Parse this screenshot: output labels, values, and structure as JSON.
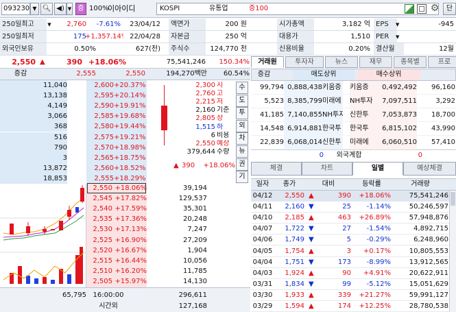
{
  "toolbar": {
    "code": "093230",
    "pct_badge": "100%",
    "name": "이아이디",
    "market": "KOSPI",
    "sector": "유통업",
    "margin": "증100"
  },
  "info": {
    "r1": [
      "250일최고",
      "2,760",
      "-7.61%",
      "23/04/12",
      "액면가",
      "200 원",
      "시가총액",
      "3,182 억",
      "EPS",
      "-945"
    ],
    "r2": [
      "250일최저",
      "175",
      "+1,357.14%",
      "22/04/28",
      "자본금",
      "250 억",
      "대용가",
      "1,510",
      "PER",
      ""
    ],
    "r3": [
      "외국인보유",
      "0.50%",
      "627(천)",
      "주식수",
      "124,770 천",
      "신용비율",
      "0.20%",
      "결산월",
      "12월"
    ]
  },
  "price": {
    "now": "2,550",
    "arrow": "▲",
    "chg": "390",
    "pct": "+18.06%",
    "vol": "75,541,246",
    "ratio": "150.34%"
  },
  "sub": {
    "label": "증감",
    "v1": "2,555",
    "v2": "2,550",
    "amt": "194,270백만",
    "turn": "60.54%"
  },
  "asks": [
    {
      "q": "11,040",
      "p": "2,600",
      "r": "+20.37%"
    },
    {
      "q": "13,138",
      "p": "2,595",
      "r": "+20.14%"
    },
    {
      "q": "4,149",
      "p": "2,590",
      "r": "+19.91%"
    },
    {
      "q": "3,066",
      "p": "2,585",
      "r": "+19.68%"
    },
    {
      "q": "368",
      "p": "2,580",
      "r": "+19.44%"
    },
    {
      "q": "516",
      "p": "2,575",
      "r": "+19.21%"
    },
    {
      "q": "790",
      "p": "2,570",
      "r": "+18.98%"
    },
    {
      "q": "3",
      "p": "2,565",
      "r": "+18.75%"
    },
    {
      "q": "13,872",
      "p": "2,560",
      "r": "+18.52%"
    },
    {
      "q": "18,853",
      "p": "2,555",
      "r": "+18.29%"
    }
  ],
  "bids": [
    {
      "p": "2,550",
      "r": "+18.06%",
      "q": "39,194"
    },
    {
      "p": "2,545",
      "r": "+17.82%",
      "q": "129,537"
    },
    {
      "p": "2,540",
      "r": "+17.59%",
      "q": "35,301"
    },
    {
      "p": "2,535",
      "r": "+17.36%",
      "q": "20,248"
    },
    {
      "p": "2,530",
      "r": "+17.13%",
      "q": "7,247"
    },
    {
      "p": "2,525",
      "r": "+16.90%",
      "q": "27,209"
    },
    {
      "p": "2,520",
      "r": "+16.67%",
      "q": "1,904"
    },
    {
      "p": "2,515",
      "r": "+16.44%",
      "q": "10,056"
    },
    {
      "p": "2,510",
      "r": "+16.20%",
      "q": "11,785"
    },
    {
      "p": "2,505",
      "r": "+15.97%",
      "q": "14,130"
    }
  ],
  "ohlc": [
    {
      "v": "2,300",
      "k": "시",
      "c": "red"
    },
    {
      "v": "2,760",
      "k": "고",
      "c": "red"
    },
    {
      "v": "2,215",
      "k": "저",
      "c": "red"
    },
    {
      "v": "2,160",
      "k": "기준",
      "c": "black"
    },
    {
      "v": "2,805",
      "k": "상",
      "c": "red"
    },
    {
      "v": "1,515",
      "k": "하",
      "c": "blue"
    },
    {
      "v": "6",
      "k": "비용",
      "c": "black"
    },
    {
      "v": "2,550",
      "k": "예상",
      "c": "red"
    },
    {
      "v": "379,644",
      "k": "수량",
      "c": "black"
    }
  ],
  "expected": {
    "arrow": "▲",
    "chg": "390",
    "pct": "+18.06%"
  },
  "side_buttons": [
    "수",
    "도",
    "투",
    "외",
    "차",
    "뉴",
    "권",
    "기"
  ],
  "totals": {
    "ask_total": "65,795",
    "time": "16:00:00",
    "bid_total": "296,611",
    "after_label": "시간외",
    "after_qty": "127,168"
  },
  "rtabs": [
    "거래원",
    "투자자",
    "뉴스",
    "재무",
    "종목별",
    "프로"
  ],
  "broker": {
    "h_sell": "매도상위",
    "h_buy": "매수상위",
    "lbl": "증감",
    "rows": [
      [
        "99,794",
        "0,888,438",
        "키움증",
        "키움증",
        "0,492,492",
        "96,160"
      ],
      [
        "5,523",
        "8,385,799",
        "미래에",
        "NH투자",
        "7,097,511",
        "3,292"
      ],
      [
        "41,185",
        "7,140,855",
        "NH투자",
        "신한투",
        "7,053,873",
        "18,700"
      ],
      [
        "14,548",
        "6,914,881",
        "한국투",
        "한국투",
        "6,815,102",
        "43,990"
      ],
      [
        "22,839",
        "6,068,014",
        "신한투",
        "미래에",
        "6,060,510",
        "57,410"
      ]
    ],
    "foreign": [
      "0",
      "외국계합",
      "0"
    ]
  },
  "btabs": [
    "체결",
    "차트",
    "일별",
    "예상체결"
  ],
  "daily": {
    "head": [
      "일자",
      "종가",
      "대비",
      "등락률",
      "거래량"
    ],
    "rows": [
      [
        "04/12",
        "2,550",
        "▲",
        "390",
        "+18.06%",
        "75,541,246",
        "red"
      ],
      [
        "04/11",
        "2,160",
        "▼",
        "25",
        "-1.14%",
        "50,246,597",
        "blue"
      ],
      [
        "04/10",
        "2,185",
        "▲",
        "463",
        "+26.89%",
        "57,948,876",
        "red"
      ],
      [
        "04/07",
        "1,722",
        "▼",
        "27",
        "-1.54%",
        "4,892,715",
        "blue"
      ],
      [
        "04/06",
        "1,749",
        "▼",
        "5",
        "-0.29%",
        "6,248,960",
        "blue"
      ],
      [
        "04/05",
        "1,754",
        "▲",
        "3",
        "+0.17%",
        "10,805,553",
        "red"
      ],
      [
        "04/04",
        "1,751",
        "▼",
        "173",
        "-8.99%",
        "13,912,565",
        "blue"
      ],
      [
        "04/03",
        "1,924",
        "▲",
        "90",
        "+4.91%",
        "20,622,911",
        "red"
      ],
      [
        "03/31",
        "1,834",
        "▼",
        "99",
        "-5.12%",
        "15,051,629",
        "blue"
      ],
      [
        "03/30",
        "1,933",
        "▲",
        "339",
        "+21.27%",
        "59,991,127",
        "red"
      ],
      [
        "03/29",
        "1,594",
        "▲",
        "174",
        "+12.25%",
        "28,780,538",
        "red"
      ]
    ]
  },
  "colors": {
    "up": "#e0141e",
    "down": "#1030d0",
    "ask_bg": "#dce9f6",
    "bid_bg": "#fbe3e3"
  }
}
